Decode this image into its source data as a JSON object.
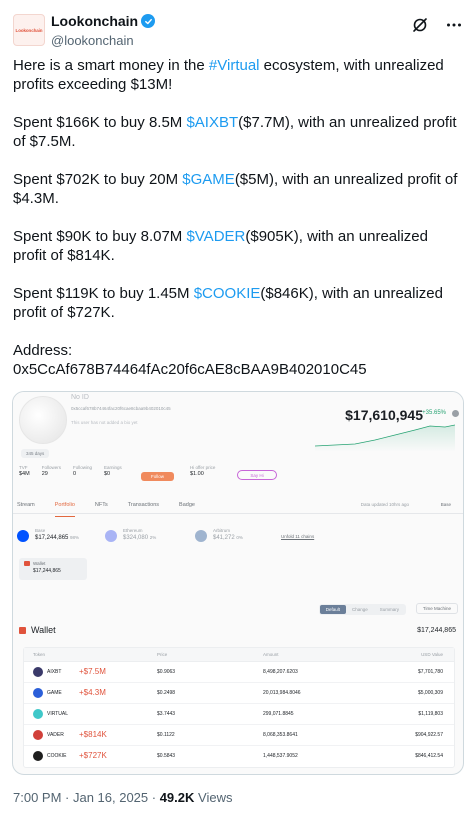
{
  "tweet": {
    "display_name": "Lookonchain",
    "handle": "@lookonchain",
    "avatar_text": "Lookonchain",
    "intro_a": "Here is a smart money in the ",
    "intro_tag": "#Virtual",
    "intro_b": " ecosystem, with unrealized profits exceeding $13M!",
    "lines": [
      {
        "pre": "Spent $166K to buy 8.5M ",
        "tag": "$AIXBT",
        "post": "($7.7M), with an unrealized profit of $7.5M."
      },
      {
        "pre": "Spent $702K to buy 20M ",
        "tag": "$GAME",
        "post": "($5M), with an unrealized profit of $4.3M."
      },
      {
        "pre": "Spent $90K to buy 8.07M ",
        "tag": "$VADER",
        "post": "($905K), with an unrealized profit of $814K."
      },
      {
        "pre": "Spent $119K to buy 1.45M ",
        "tag": "$COOKIE",
        "post": "($846K), with an unrealized profit of $727K."
      }
    ],
    "address_label": "Address:",
    "address": "0x5CcAf678B74464fAc20f6cAE8cBAA9B402010C45",
    "timestamp": "7:00 PM · Jan 16, 2025 · ",
    "views_count": "49.2K",
    "views_label": " Views",
    "icons": {
      "grok": "grok-icon",
      "more": "more-icon",
      "verified": "verified-badge-icon"
    }
  },
  "embed": {
    "profile": {
      "name": "No ID",
      "address": "0x5ccaf678b74464fac20f6cae8cbaa9b402010c45",
      "bio": "This user has not added a bio yet",
      "total_value": "$17,610,945",
      "change": "+35.65%",
      "days": "345 days",
      "stats": [
        {
          "label": "TVF",
          "value": "$4M"
        },
        {
          "label": "Followers",
          "value": "29"
        },
        {
          "label": "Following",
          "value": "0"
        },
        {
          "label": "Earnings",
          "value": "$0"
        }
      ],
      "follow_label": "Follow",
      "offer_label": "Hi offer price",
      "offer_value": "$1.00",
      "sayhi_label": "Say Hi"
    },
    "tabs": [
      "Stream",
      "Portfolio",
      "NFTs",
      "Transactions",
      "Badge"
    ],
    "active_tab": "Portfolio",
    "data_updated": "Data updated 10hrs ago",
    "base_select": "Base",
    "chains": [
      {
        "name": "Base",
        "value": "$17,244,865",
        "pct": "98%",
        "color": "#0052ff"
      },
      {
        "name": "Ethereum",
        "value": "$324,080",
        "pct": "2%",
        "color": "#a9b4f5"
      },
      {
        "name": "Arbitrum",
        "value": "$41,272",
        "pct": "0%",
        "color": "#9fb4cf"
      }
    ],
    "unfold_label": "Unfold 11 chains",
    "wallet_chip": {
      "label": "Wallet",
      "value": "$17,244,865"
    },
    "view_modes": [
      "Default",
      "Change",
      "Summary"
    ],
    "time_machine": "Time Machine",
    "wallet_title": "Wallet",
    "wallet_total": "$17,244,865",
    "table": {
      "headers": [
        "Token",
        "Price",
        "Amount",
        "USD Value"
      ],
      "rows": [
        {
          "token": "AIXBT",
          "profit": "+$7.5M",
          "price": "$0.9063",
          "amount": "8,498,207.6203",
          "usd": "$7,701,780",
          "color": "#3a3a6a"
        },
        {
          "token": "GAME",
          "profit": "+$4.3M",
          "price": "$0.2498",
          "amount": "20,013,984.8046",
          "usd": "$5,000,309",
          "color": "#2b5fd9"
        },
        {
          "token": "VIRTUAL",
          "profit": "",
          "price": "$3.7443",
          "amount": "299,071.8845",
          "usd": "$1,119,803",
          "color": "#3fc8c9"
        },
        {
          "token": "VADER",
          "profit": "+$814K",
          "price": "$0.1122",
          "amount": "8,068,353.8641",
          "usd": "$904,922.57",
          "color": "#d1403a"
        },
        {
          "token": "COOKIE",
          "profit": "+$727K",
          "price": "$0.5843",
          "amount": "1,448,537.9052",
          "usd": "$846,412.54",
          "color": "#1e1e1e"
        }
      ]
    }
  }
}
